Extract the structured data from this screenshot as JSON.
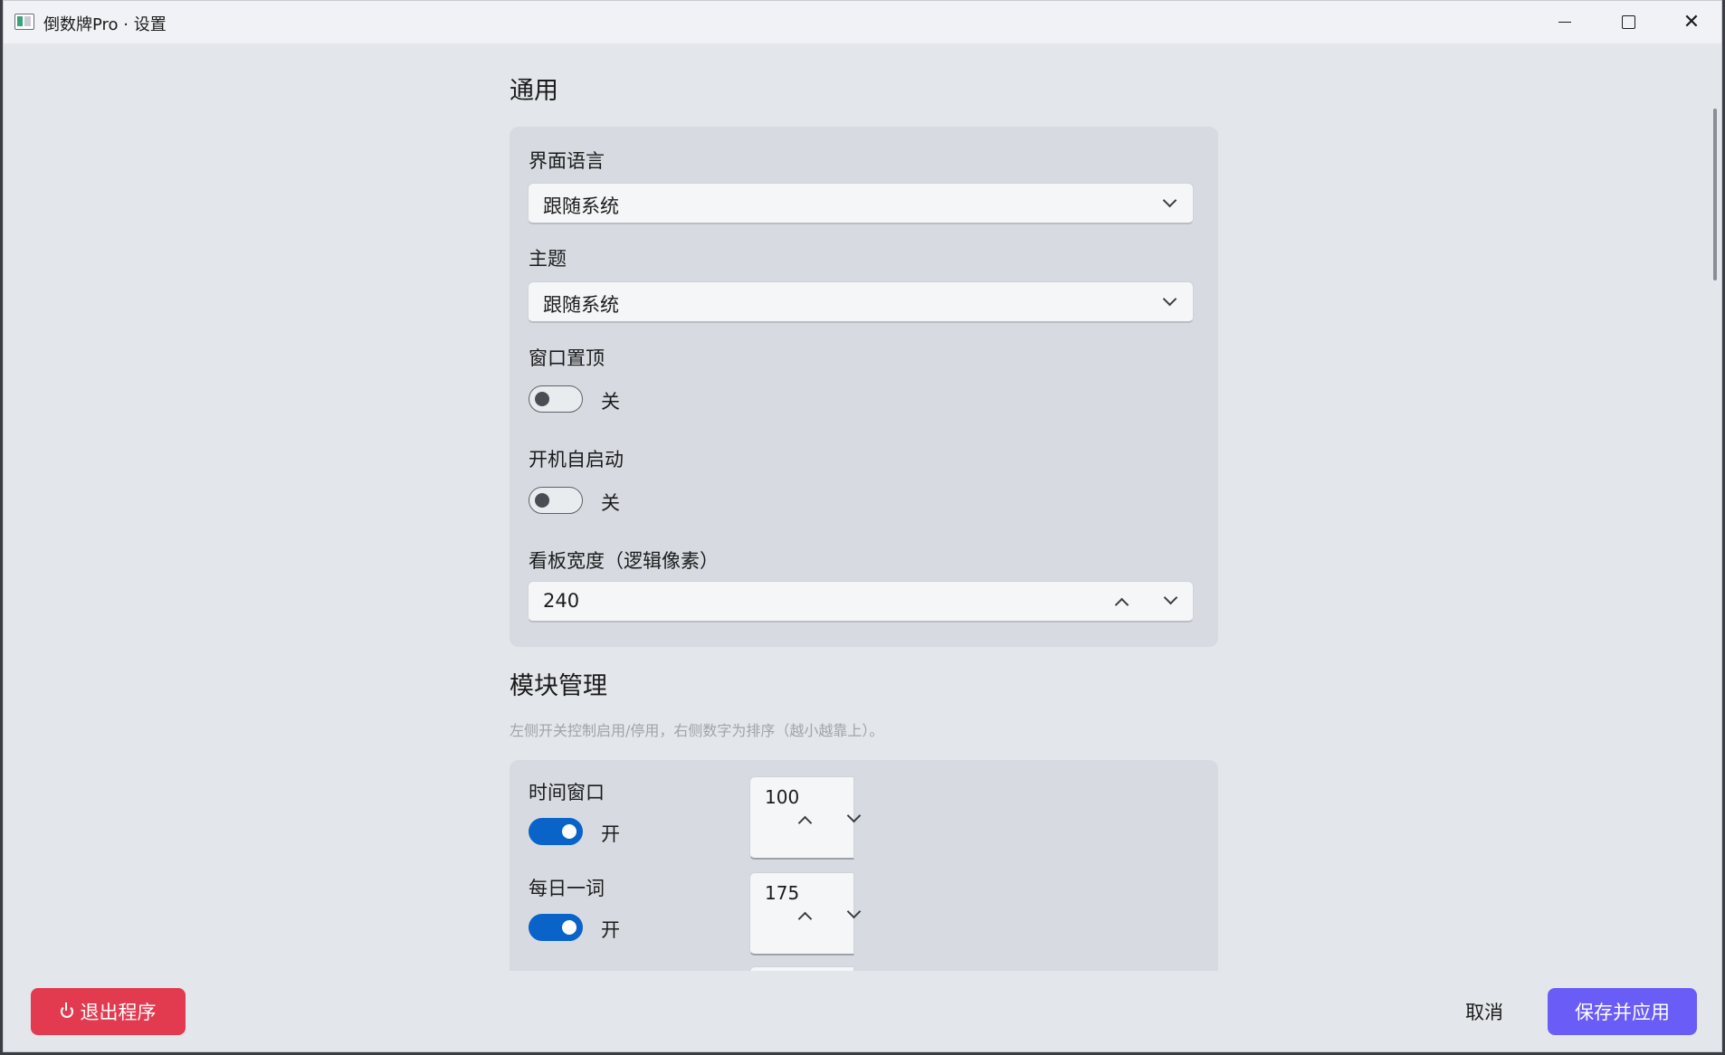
{
  "window": {
    "title": "倒数牌Pro · 设置"
  },
  "general": {
    "heading": "通用",
    "language_label": "界面语言",
    "language_value": "跟随系统",
    "theme_label": "主题",
    "theme_value": "跟随系统",
    "always_on_top_label": "窗口置顶",
    "always_on_top_state": "关",
    "always_on_top_on": false,
    "autostart_label": "开机自启动",
    "autostart_state": "关",
    "autostart_on": false,
    "board_width_label": "看板宽度（逻辑像素）",
    "board_width_value": "240"
  },
  "modules": {
    "heading": "模块管理",
    "hint": "左侧开关控制启用/停用，右侧数字为排序（越小越靠上）。",
    "items": [
      {
        "label": "时间窗口",
        "state": "开",
        "on": true,
        "order": "100"
      },
      {
        "label": "每日一词",
        "state": "开",
        "on": true,
        "order": "175"
      }
    ]
  },
  "footer": {
    "exit_label": "退出程序",
    "cancel_label": "取消",
    "save_label": "保存并应用"
  },
  "colors": {
    "accent": "#0a63c8",
    "danger": "#e23a4f",
    "primary": "#6a5cf6"
  },
  "icons": [
    "app-icon",
    "minimize-icon",
    "maximize-icon",
    "close-icon",
    "chevron-down-icon",
    "chevron-up-icon",
    "power-icon"
  ]
}
